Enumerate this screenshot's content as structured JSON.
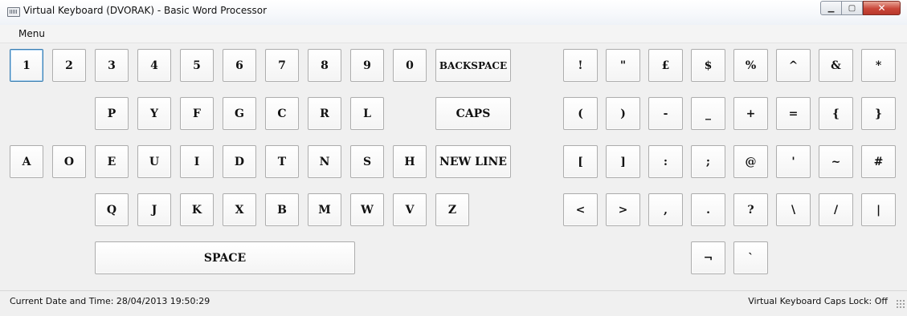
{
  "window": {
    "title": "Virtual Keyboard (DVORAK) - Basic Word Processor",
    "minimize_glyph": "▁",
    "maximize_glyph": "▢",
    "close_glyph": "✕"
  },
  "menu": {
    "label": "Menu"
  },
  "keys": {
    "num_1": "1",
    "num_2": "2",
    "num_3": "3",
    "num_4": "4",
    "num_5": "5",
    "num_6": "6",
    "num_7": "7",
    "num_8": "8",
    "num_9": "9",
    "num_0": "0",
    "backspace": "BACKSPACE",
    "caps": "CAPS",
    "new_line": "NEW LINE",
    "space": "SPACE",
    "p": "P",
    "y": "Y",
    "f": "F",
    "g": "G",
    "c": "C",
    "r": "R",
    "l": "L",
    "a": "A",
    "o": "O",
    "e": "E",
    "u": "U",
    "i": "I",
    "d": "D",
    "h": "H",
    "t": "T",
    "n": "N",
    "s": "S",
    "q": "Q",
    "j": "J",
    "k": "K",
    "x": "X",
    "b": "B",
    "m": "M",
    "w": "W",
    "v": "V",
    "z": "Z",
    "exclamation": "!",
    "double_quote": "\"",
    "pound": "£",
    "dollar": "$",
    "percent": "%",
    "caret": "^",
    "ampersand": "&",
    "asterisk": "*",
    "open_paren": "(",
    "close_paren": ")",
    "minus": "-",
    "underscore": "_",
    "plus": "+",
    "equals": "=",
    "open_brace": "{",
    "close_brace": "}",
    "open_bracket": "[",
    "close_bracket": "]",
    "colon": ":",
    "semicolon": ";",
    "at": "@",
    "apostrophe": "'",
    "tilde": "~",
    "hash": "#",
    "less_than": "<",
    "greater_than": ">",
    "comma": ",",
    "period": ".",
    "question": "?",
    "backslash": "\\",
    "slash": "/",
    "pipe": "|",
    "not_sign": "¬",
    "backtick": "`"
  },
  "status": {
    "datetime": "Current Date and Time:  28/04/2013 19:50:29",
    "caps_lock": "Virtual Keyboard Caps Lock: Off"
  }
}
